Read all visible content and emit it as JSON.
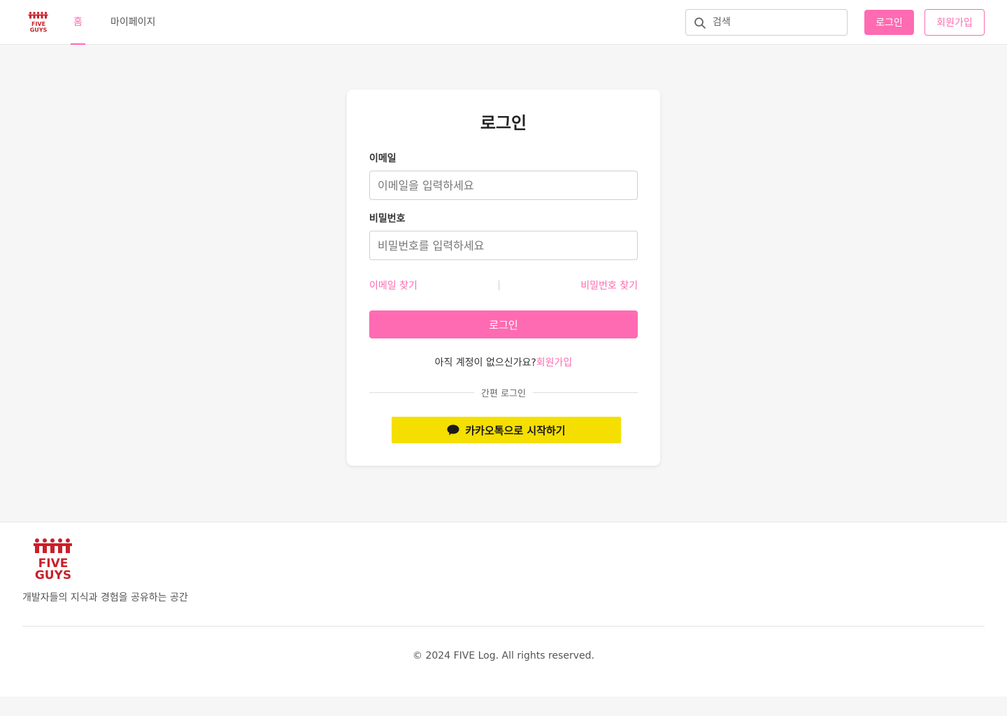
{
  "header": {
    "logo_text_top": "FIVE",
    "logo_text_bottom": "GUYS",
    "nav": {
      "home": "홈",
      "mypage": "마이페이지"
    },
    "search": {
      "placeholder": "검색"
    },
    "login_label": "로그인",
    "signup_label": "회원가입"
  },
  "login_card": {
    "title": "로그인",
    "email_label": "이메일",
    "email_placeholder": "이메일을 입력하세요",
    "password_label": "비밀번호",
    "password_placeholder": "비밀번호를 입력하세요",
    "find_email": "이메일 찾기",
    "find_password": "비밀번호 찾기",
    "login_button": "로그인",
    "no_account_text": "아직 계정이 없으신가요?",
    "signup_link": "회원가입",
    "divider_text": "간편 로그인",
    "kakao_button": "카카오톡으로 시작하기"
  },
  "footer": {
    "logo_text_top": "FIVE",
    "logo_text_bottom": "GUYS",
    "description": "개발자들의 지식과 경험을 공유하는 공간",
    "copyright": "© 2024 FIVE Log. All rights reserved."
  },
  "colors": {
    "accent": "#ff6bb2",
    "kakao": "#f5df00",
    "logo_red": "#c9202a"
  }
}
